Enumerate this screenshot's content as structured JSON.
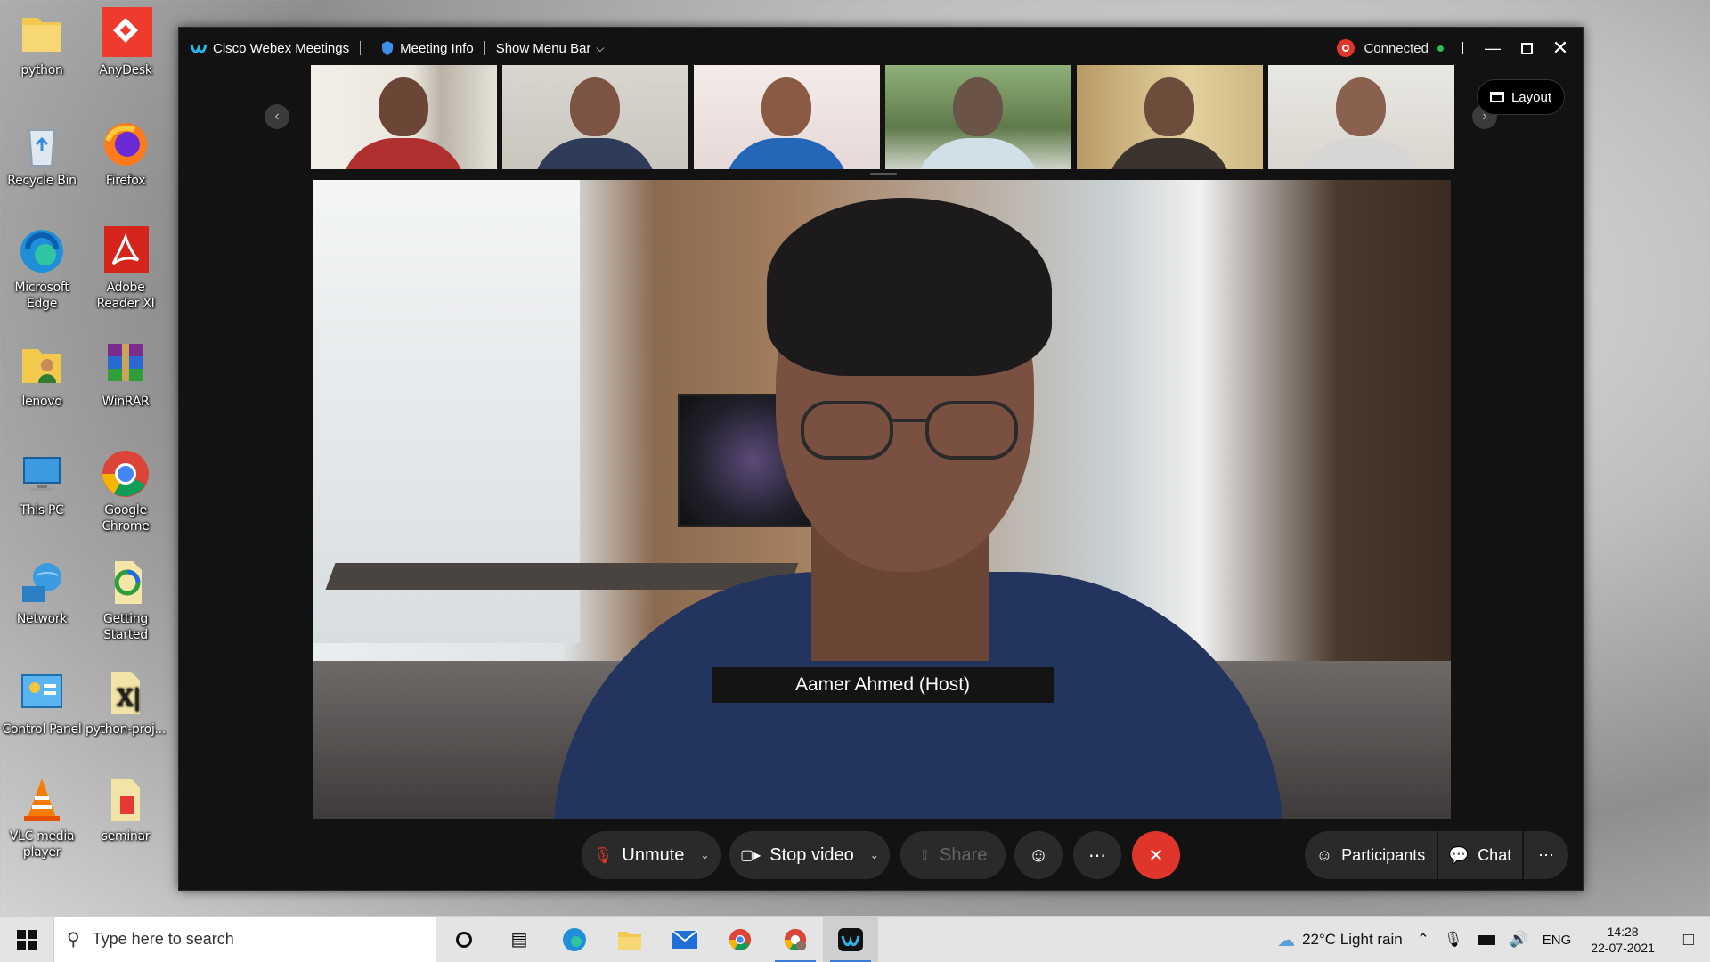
{
  "desktop_icons": [
    {
      "label": "python",
      "icon": "folder-icon"
    },
    {
      "label": "AnyDesk",
      "icon": "anydesk-icon"
    },
    {
      "label": "Recycle Bin",
      "icon": "recycle-bin-icon"
    },
    {
      "label": "Firefox",
      "icon": "firefox-icon"
    },
    {
      "label": "Microsoft Edge",
      "icon": "edge-icon"
    },
    {
      "label": "Adobe Reader XI",
      "icon": "adobe-reader-icon"
    },
    {
      "label": "lenovo",
      "icon": "user-folder-icon"
    },
    {
      "label": "WinRAR",
      "icon": "winrar-icon"
    },
    {
      "label": "This PC",
      "icon": "computer-icon"
    },
    {
      "label": "Google Chrome",
      "icon": "chrome-icon"
    },
    {
      "label": "Network",
      "icon": "network-icon"
    },
    {
      "label": "Getting Started",
      "icon": "getting-started-icon"
    },
    {
      "label": "Control Panel",
      "icon": "control-panel-icon"
    },
    {
      "label": "python-proj...",
      "icon": "python-project-icon"
    },
    {
      "label": "VLC media player",
      "icon": "vlc-icon"
    },
    {
      "label": "seminar",
      "icon": "document-folder-icon"
    }
  ],
  "webex": {
    "app_title": "Cisco Webex Meetings",
    "meeting_info": "Meeting Info",
    "show_menu_bar": "Show Menu Bar",
    "status": "Connected",
    "layout_label": "Layout",
    "active_speaker": "Aamer Ahmed (Host)",
    "controls": {
      "unmute": "Unmute",
      "stop_video": "Stop video",
      "share": "Share",
      "participants": "Participants",
      "chat": "Chat"
    },
    "colors": {
      "end_call": "#e0352b",
      "connected": "#2fbd59",
      "control_bg": "#2a2a2a"
    }
  },
  "taskbar": {
    "search_placeholder": "Type here to search",
    "weather": "22°C  Light rain",
    "language": "ENG",
    "time": "14:28",
    "date": "22-07-2021"
  }
}
